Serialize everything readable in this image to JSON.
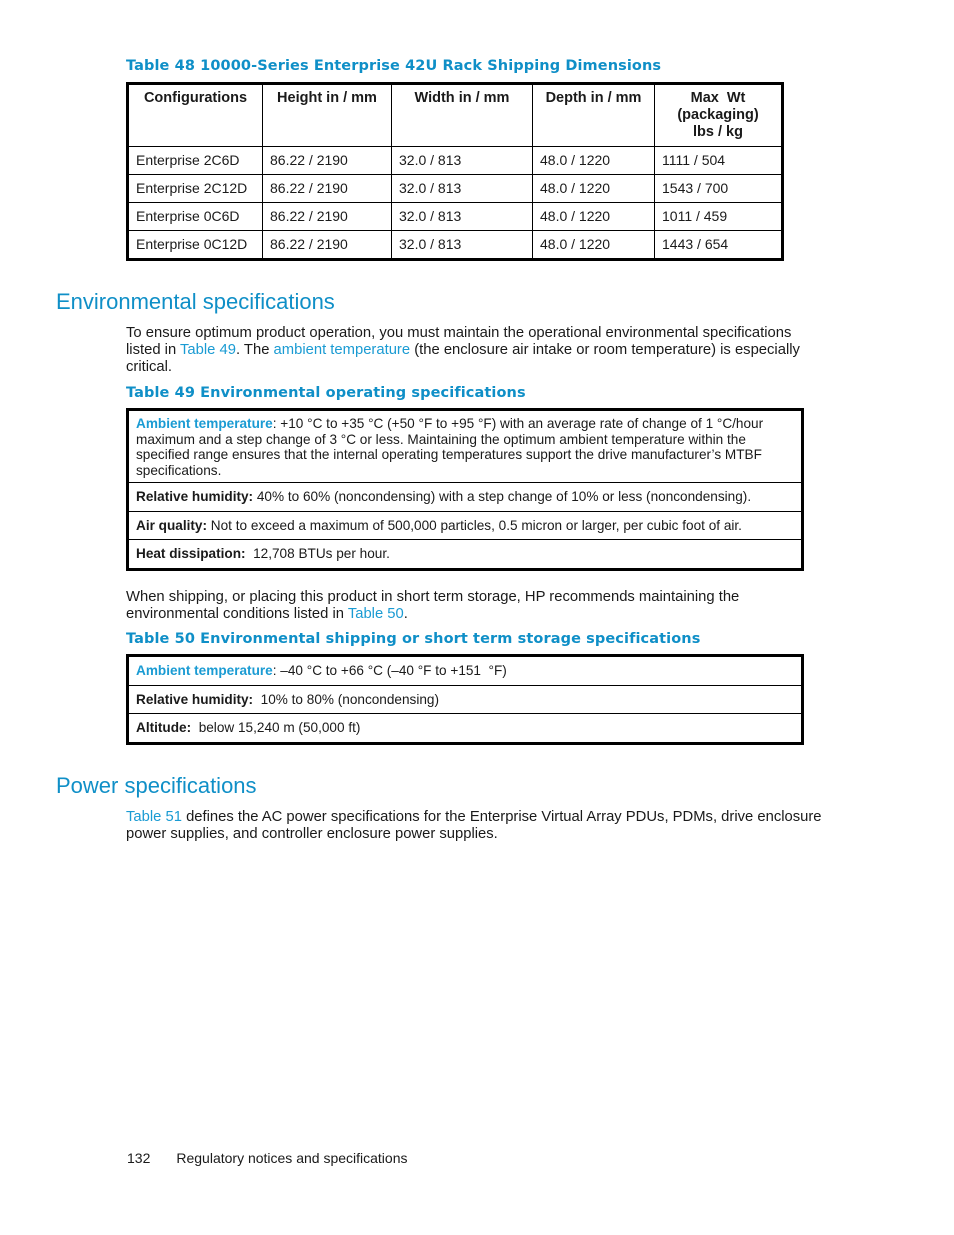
{
  "table48": {
    "caption": "Table 48 10000-Series Enterprise 42U Rack Shipping Dimensions",
    "headers": [
      "Configurations",
      "Height in / mm",
      "Width in / mm",
      "Depth in / mm",
      "Max  Wt",
      "(packaging)",
      "lbs / kg"
    ],
    "rows": [
      [
        "Enterprise 2C6D",
        "86.22 / 2190",
        "32.0 / 813",
        "48.0 / 1220",
        "1111 / 504"
      ],
      [
        "Enterprise 2C12D",
        "86.22 / 2190",
        "32.0 / 813",
        "48.0 / 1220",
        "1543 / 700"
      ],
      [
        "Enterprise 0C6D",
        "86.22 / 2190",
        "32.0 / 813",
        "48.0 / 1220",
        "1011 / 459"
      ],
      [
        "Enterprise 0C12D",
        "86.22 / 2190",
        "32.0 / 813",
        "48.0 / 1220",
        "1443 / 654"
      ]
    ]
  },
  "env_section": {
    "heading": "Environmental specifications",
    "para": {
      "t1": "To ensure optimum product operation, you must maintain the operational environmental specifications listed in ",
      "link1": "Table 49",
      "t2": ". The ",
      "link2": "ambient temperature",
      "t3": " (the enclosure air intake or room temperature) is especially critical."
    }
  },
  "table49": {
    "caption": "Table 49 Environmental operating specifications",
    "rows": [
      {
        "label": "Ambient temperature",
        "sep": ": ",
        "text": "+10 °C to +35 °C (+50 °F to +95 °F) with an average rate of change of 1 °C/hour maximum and a step change of 3 °C or less.  Maintaining the optimum ambient temperature within the specified range ensures that the internal operating temperatures support the drive manufacturer’s MTBF specifications."
      },
      {
        "label": "Relative humidity:",
        "sep": " ",
        "text": "40% to 60% (noncondensing) with a step change of 10% or less (noncondensing)."
      },
      {
        "label": "Air quality:",
        "sep": " ",
        "text": "Not to exceed a maximum of 500,000 particles, 0.5 micron or larger, per cubic foot of air."
      },
      {
        "label": "Heat dissipation:",
        "sep": "  ",
        "text": "12,708 BTUs per hour."
      }
    ]
  },
  "shipping_para": {
    "t1": "When shipping, or placing this product in short term storage, HP recommends maintaining the environmental conditions listed in ",
    "link": "Table 50",
    "t2": "."
  },
  "table50": {
    "caption": "Table 50 Environmental shipping or short term storage specifications",
    "rows": [
      {
        "label": "Ambient temperature",
        "sep": ": ",
        "text": "–40 °C to +66 °C (–40 °F to +151  °F)"
      },
      {
        "label": "Relative humidity:",
        "sep": "  ",
        "text": "10% to 80% (noncondensing)"
      },
      {
        "label": "Altitude:",
        "sep": "  ",
        "text": "below 15,240 m (50,000 ft)"
      }
    ]
  },
  "power_section": {
    "heading": "Power specifications",
    "para": {
      "link": "Table 51",
      "text": " defines the AC power specifications for the Enterprise Virtual Array PDUs, PDMs, drive enclosure power supplies, and controller enclosure power supplies."
    }
  },
  "footer": {
    "page_number": "132",
    "chapter_title": "Regulatory notices and specifications"
  }
}
